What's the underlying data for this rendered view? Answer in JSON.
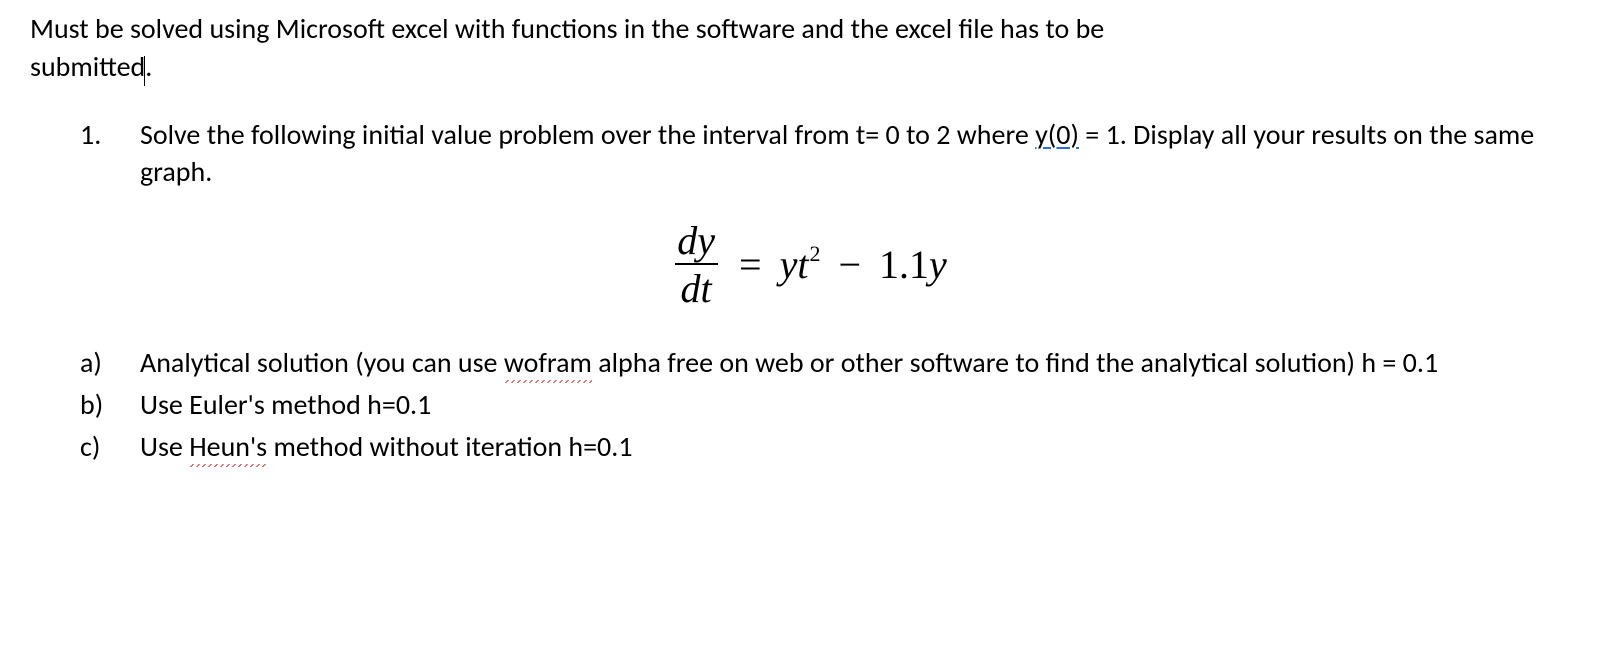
{
  "intro": {
    "line1": "Must be solved using Microsoft excel with functions in the software and the excel file has to be",
    "line2": "submitted"
  },
  "problem": {
    "marker": "1.",
    "text_before_y0": "Solve the following initial value problem over the interval from t= 0 to 2 where ",
    "y0": "y(0)",
    "text_after_y0": " = 1. Display all your results on the same graph."
  },
  "equation": {
    "dy": "dy",
    "dt": "dt",
    "eq": "=",
    "yt": "yt",
    "exp": "2",
    "minus": "−",
    "coef_pre": "1.1",
    "coef_var": "y"
  },
  "parts": {
    "a": {
      "marker": "a)",
      "pre": "Analytical solution (you can use ",
      "squiggle": "wofram",
      "post": " alpha free on web or other software to find the analytical solution) h = 0.1"
    },
    "b": {
      "marker": "b)",
      "text": "Use Euler's method h=0.1"
    },
    "c": {
      "marker": "c)",
      "pre": "Use ",
      "squiggle": "Heun's",
      "post": " method without iteration h=0.1"
    }
  }
}
